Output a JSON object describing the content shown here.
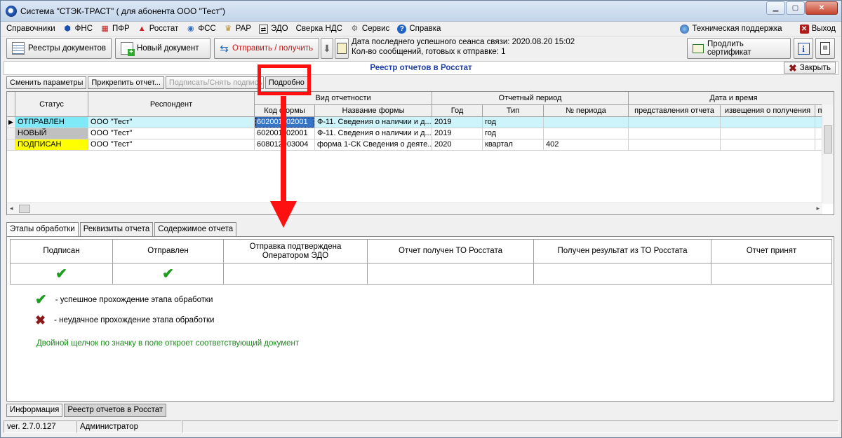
{
  "window": {
    "title": "Система \"СТЭК-ТРАСТ\" ( для абонента ООО \"Тест\")",
    "minimize_glyph": "▁",
    "maximize_glyph": "▢",
    "close_glyph": "✕"
  },
  "menu": {
    "items": [
      {
        "label": "Справочники",
        "icon": "none"
      },
      {
        "label": "ФНС",
        "icon": "fns-icon"
      },
      {
        "label": "ПФР",
        "icon": "pfr-icon"
      },
      {
        "label": "Росстат",
        "icon": "rosstat-icon"
      },
      {
        "label": "ФСС",
        "icon": "fss-icon"
      },
      {
        "label": "РАР",
        "icon": "rar-icon"
      },
      {
        "label": "ЭДО",
        "icon": "edo-icon"
      },
      {
        "label": "Сверка НДС",
        "icon": "none"
      },
      {
        "label": "Сервис",
        "icon": "gear-icon"
      },
      {
        "label": "Справка",
        "icon": "help-icon"
      }
    ],
    "support": "Техническая поддержка",
    "exit": "Выход"
  },
  "toolbar": {
    "registries": "Реестры документов",
    "new_doc": "Новый документ",
    "send_receive": "Отправить / получить",
    "last_session": "Дата последнего успешного сеанса связи: 2020.08.20 15:02",
    "ready_count": "Кол-во сообщений, готовых к отправке: 1",
    "renew_cert": "Продлить сертификат"
  },
  "document": {
    "title": "Реестр отчетов в Росстат",
    "close": "Закрыть"
  },
  "actions": {
    "change_params": "Сменить параметры",
    "attach_report": "Прикрепить отчет...",
    "sign": "Подписать/Снять подпись",
    "details": "Подробно"
  },
  "grid": {
    "headers": {
      "status": "Статус",
      "respondent": "Респондент",
      "report_type": "Вид отчетности",
      "form_code": "Код формы",
      "form_name": "Название формы",
      "period": "Отчетный период",
      "year": "Год",
      "type": "Тип",
      "period_no": "№ периода",
      "datetime": "Дата и время",
      "submitted": "представления отчета",
      "notice": "извещения о получения",
      "extra": "п"
    },
    "rows": [
      {
        "status": "ОТПРАВЛЕН",
        "status_color": "#7fe9f7",
        "respondent": "ООО \"Тест\"",
        "form_code": "602001102001",
        "form_name": "Ф-11. Сведения о наличии и д...",
        "year": "2019",
        "type": "год",
        "period_no": "",
        "selected": true
      },
      {
        "status": "НОВЫЙ",
        "status_color": "#c0c0c0",
        "respondent": "ООО \"Тест\"",
        "form_code": "602001102001",
        "form_name": "Ф-11. Сведения о наличии и д...",
        "year": "2019",
        "type": "год",
        "period_no": "",
        "selected": false
      },
      {
        "status": "ПОДПИСАН",
        "status_color": "#ffff00",
        "respondent": "ООО \"Тест\"",
        "form_code": "608012003004",
        "form_name": "форма 1-СК Сведения о деяте...",
        "year": "2020",
        "type": "квартал",
        "period_no": "402",
        "selected": false
      }
    ]
  },
  "tabs": [
    {
      "label": "Этапы обработки",
      "active": true
    },
    {
      "label": "Реквизиты отчета",
      "active": false
    },
    {
      "label": "Содержимое отчета",
      "active": false
    }
  ],
  "stages": {
    "headers": [
      "Подписан",
      "Отправлен",
      "Отправка подтверждена Оператором ЭДО",
      "Отчет получен ТО Росстата",
      "Получен результат из ТО Росстата",
      "Отчет принят"
    ],
    "marks": [
      "✔",
      "✔",
      "",
      "",
      "",
      ""
    ]
  },
  "legend": {
    "success_symbol": "✔",
    "success": "-  успешное прохождение этапа обработки",
    "fail_symbol": "✖",
    "fail": "-  неудачное прохождение этапа обработки",
    "hint": "Двойной щелчок по значку в поле откроет соответствующий документ"
  },
  "bottom_tabs": [
    "Информация",
    "Реестр отчетов в Росстат"
  ],
  "status_bar": {
    "version": "ver. 2.7.0.127",
    "user": "Администратор"
  },
  "colors": {
    "accent_title": "#1d3fa8",
    "highlight": "#ff1010",
    "success": "#1e9c1e",
    "fail": "#8a1a1a"
  }
}
